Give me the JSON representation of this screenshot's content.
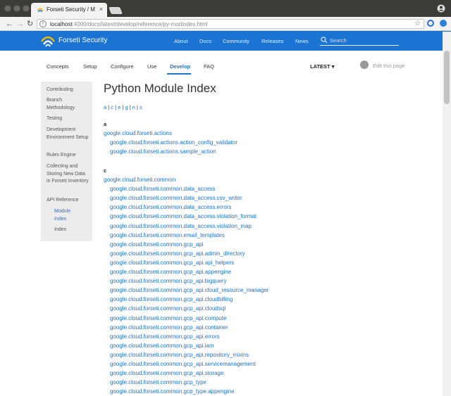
{
  "browser": {
    "tab_title": "Forseti Security / M",
    "tab_close": "×",
    "url_host": "localhost",
    "url_path": ":4000/docs/latest/develop/reference/py-modindex.html",
    "back_glyph": "←",
    "forward_glyph": "→",
    "reload_glyph": "↻",
    "star_glyph": "☆",
    "info_glyph": "i"
  },
  "site": {
    "brand": "Forseti Security",
    "nav": [
      "About",
      "Docs",
      "Community",
      "Releases",
      "News"
    ],
    "search_placeholder": "Search"
  },
  "subnav": {
    "items": [
      "Concepts",
      "Setup",
      "Configure",
      "Use",
      "Develop",
      "FAQ"
    ],
    "active": "Develop",
    "version": "LATEST ▾",
    "edit_label": "Edit this page"
  },
  "sidebar": {
    "items": [
      {
        "label": "Contributing"
      },
      {
        "label": "Branch Methodology"
      },
      {
        "label": "Testing"
      },
      {
        "label": "Development Environment Setup"
      },
      {
        "label": "Rules Engine"
      },
      {
        "label": "Collecting and Storing New Data in Forseti Inventory"
      },
      {
        "label": "API Reference"
      },
      {
        "label": "Module Index"
      },
      {
        "label": "Index"
      }
    ]
  },
  "main": {
    "title": "Python Module Index",
    "alpha_letters": [
      "a",
      "c",
      "e",
      "g",
      "n",
      "s"
    ],
    "groups": [
      {
        "letter": "a",
        "top": "google.cloud.forseti.actions",
        "subs": [
          "google.cloud.forseti.actions.action_config_validator",
          "google.cloud.forseti.actions.sample_action"
        ]
      },
      {
        "letter": "c",
        "top": "google.cloud.forseti.common",
        "subs": [
          "google.cloud.forseti.common.data_access",
          "google.cloud.forseti.common.data_access.csv_writer",
          "google.cloud.forseti.common.data_access.errors",
          "google.cloud.forseti.common.data_access.violation_format",
          "google.cloud.forseti.common.data_access.violation_map",
          "google.cloud.forseti.common.email_templates",
          "google.cloud.forseti.common.gcp_api",
          "google.cloud.forseti.common.gcp_api.admin_directory",
          "google.cloud.forseti.common.gcp_api.api_helpers",
          "google.cloud.forseti.common.gcp_api.appengine",
          "google.cloud.forseti.common.gcp_api.bigquery",
          "google.cloud.forseti.common.gcp_api.cloud_resource_manager",
          "google.cloud.forseti.common.gcp_api.cloudbilling",
          "google.cloud.forseti.common.gcp_api.cloudsql",
          "google.cloud.forseti.common.gcp_api.compute",
          "google.cloud.forseti.common.gcp_api.container",
          "google.cloud.forseti.common.gcp_api.errors",
          "google.cloud.forseti.common.gcp_api.iam",
          "google.cloud.forseti.common.gcp_api.repository_mixins",
          "google.cloud.forseti.common.gcp_api.servicemanagement",
          "google.cloud.forseti.common.gcp_api.storage",
          "google.cloud.forseti.common.gcp_type",
          "google.cloud.forseti.common.gcp_type.appengine"
        ]
      }
    ]
  },
  "colors": {
    "brand_blue": "#1b73d2",
    "link": "#1b73d2",
    "sidebar_bg": "#ececec"
  }
}
